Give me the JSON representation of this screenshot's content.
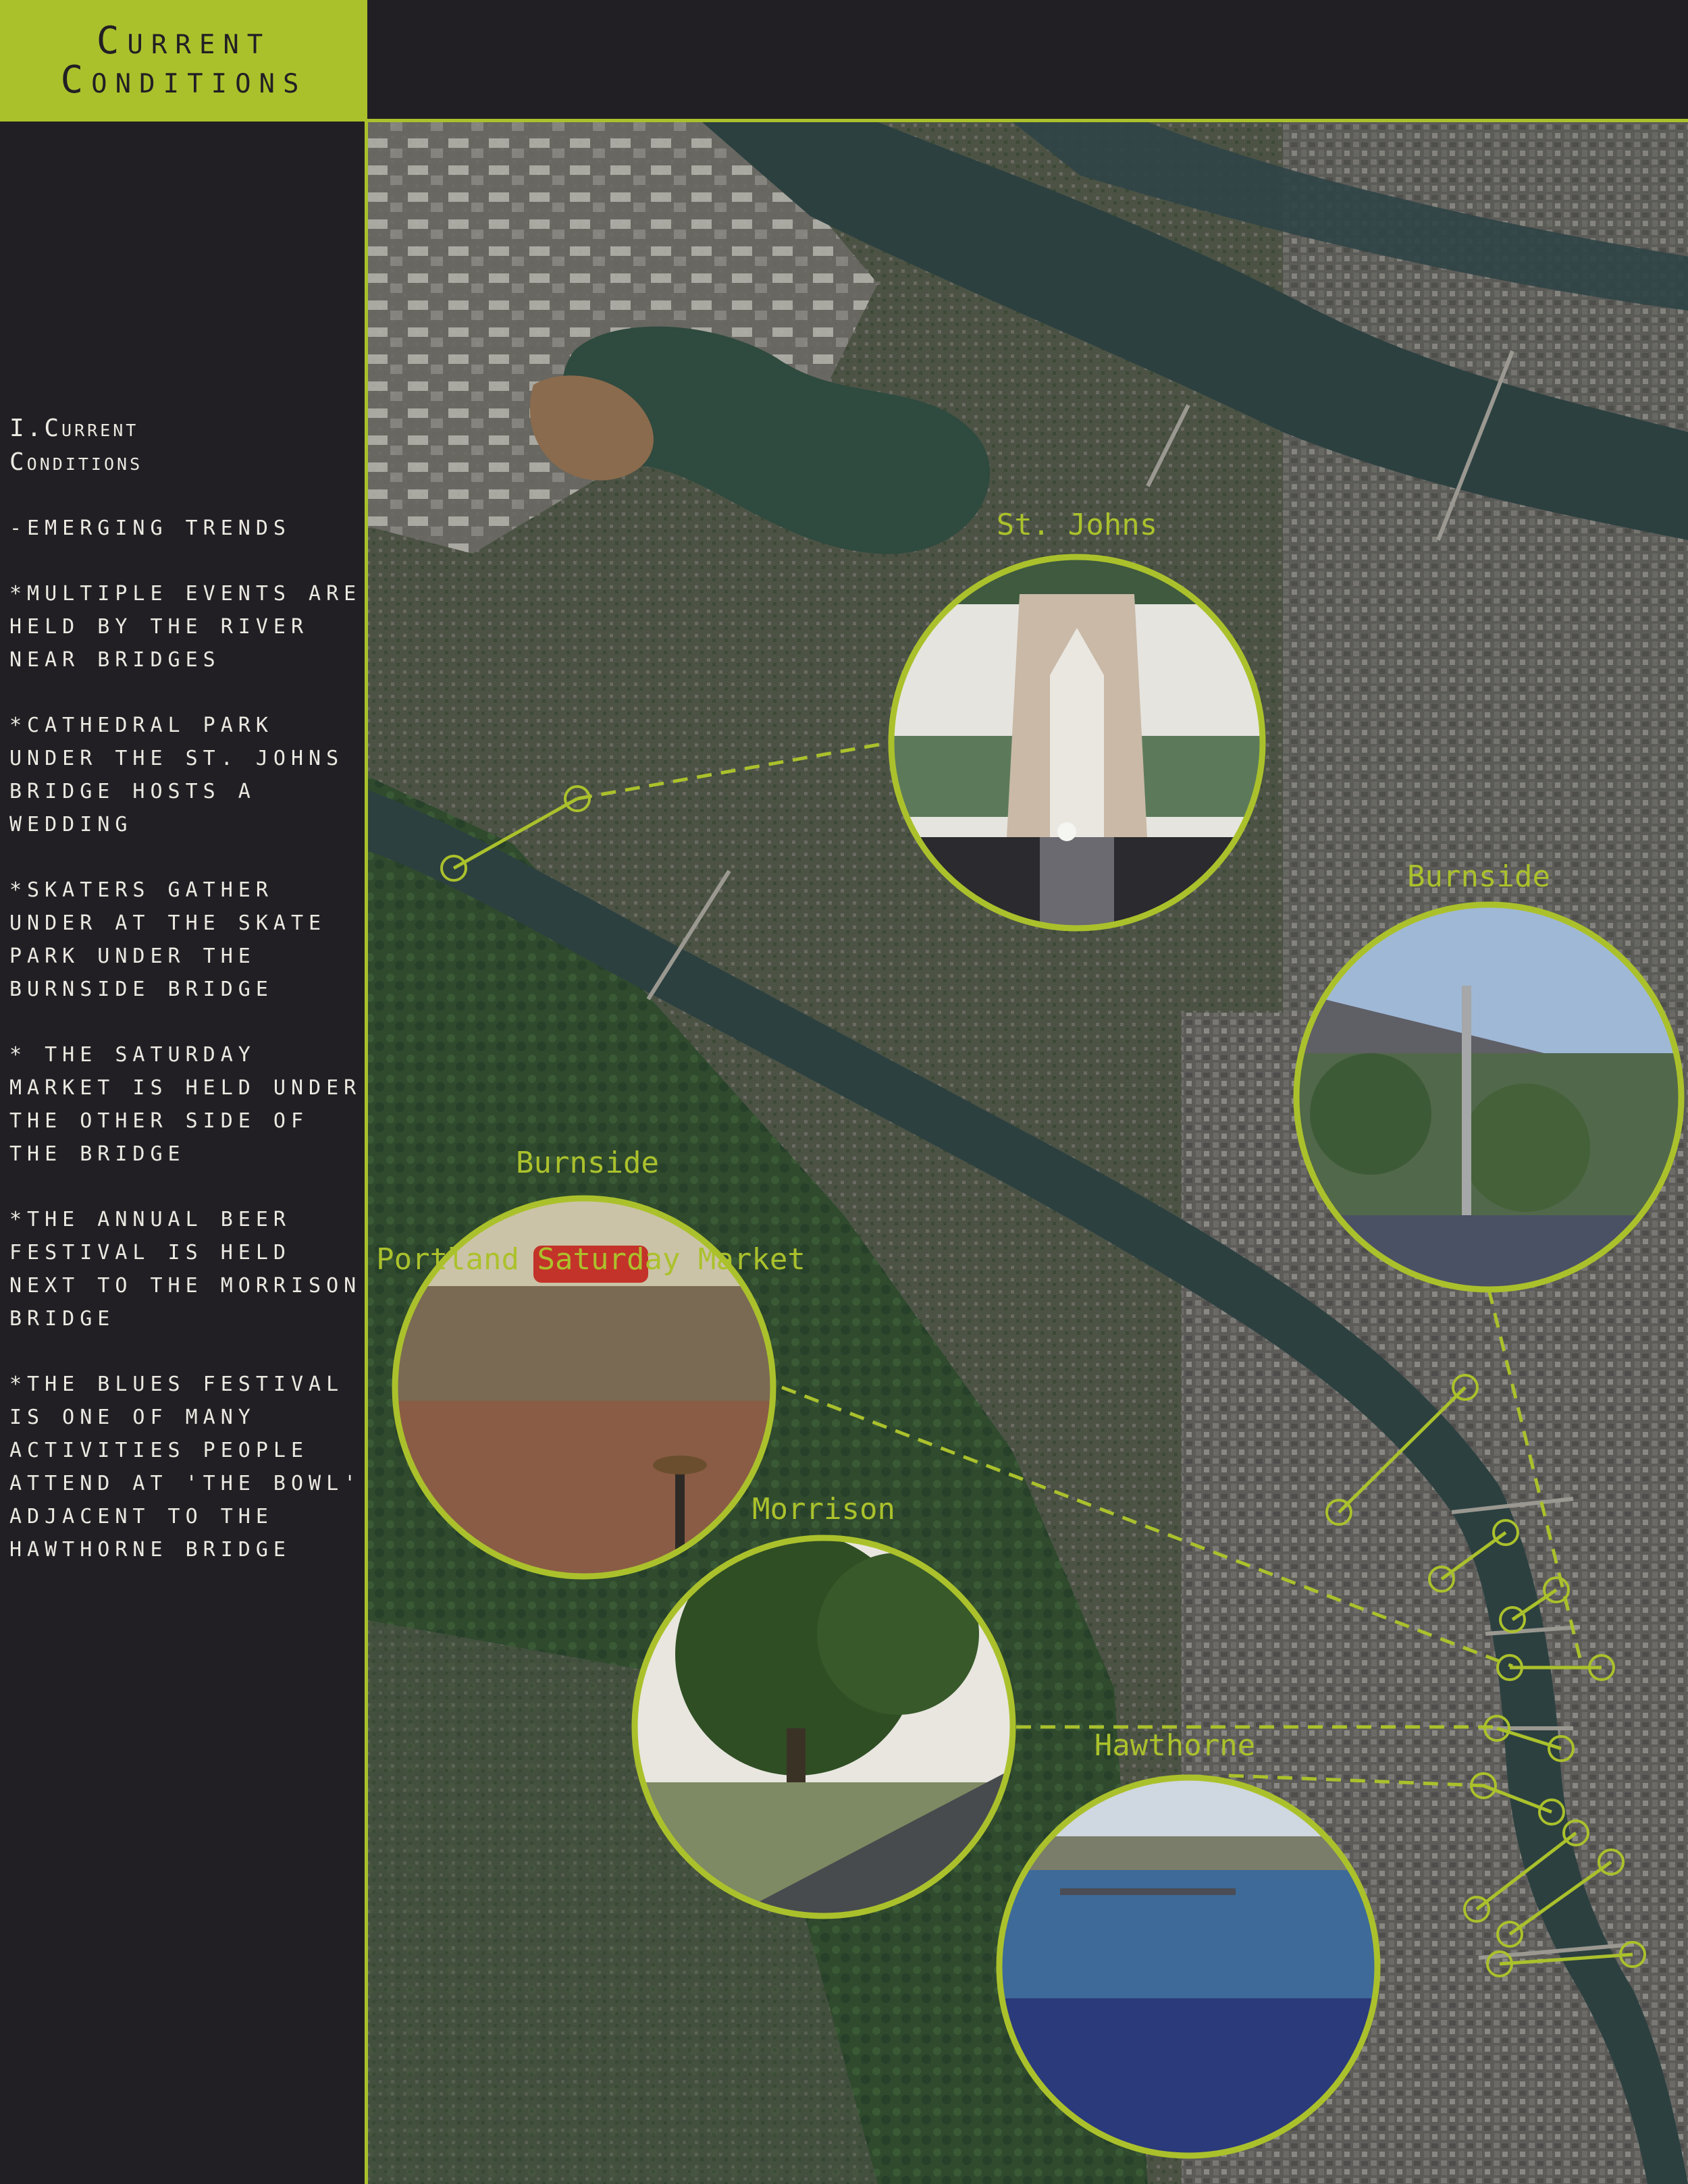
{
  "title": {
    "line1": "Current",
    "line2": "Conditions"
  },
  "sidebar": {
    "heading": "I.Current\nConditions",
    "subheading": "-emerging trends",
    "items": [
      "*multiple events are held by the river near bridges",
      "*cathedral park under the st. johns bridge hosts a wedding",
      "*skaters gather under at the skate park under the burnside bridge",
      "* the saturday market is held under the other side of the bridge",
      "*the annual beer festival is held next to the morrison bridge",
      "*the blues festival is one of many activities people attend at 'the bowl' adjacent to the hawthorne bridge"
    ]
  },
  "map": {
    "labels": {
      "st_johns": "St. Johns",
      "burnside_right": "Burnside",
      "burnside_left": "Burnside",
      "morrison": "Morrison",
      "hawthorne": "Hawthorne"
    },
    "photo_signs": {
      "market": "Portland Saturday Market"
    },
    "accent_color": "#abc12c",
    "river_color": "#2c4040"
  }
}
